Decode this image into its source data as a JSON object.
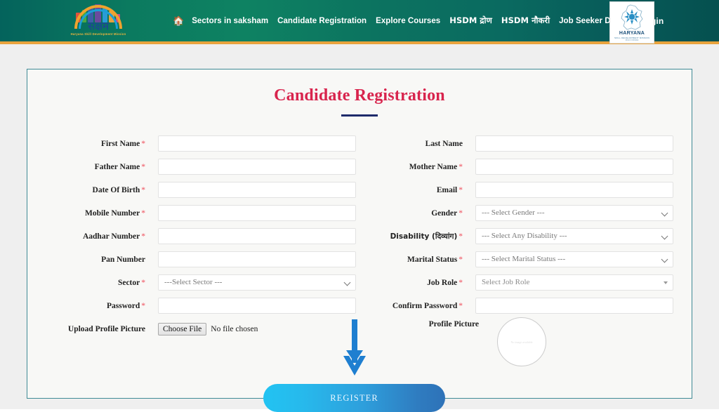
{
  "header": {
    "logo": {
      "name": "सक्षम",
      "subtitle": "Haryana Skill Development Mission"
    },
    "nav": {
      "home_icon": "home-icon",
      "items": [
        {
          "label": "Sectors in saksham",
          "script": "latin"
        },
        {
          "label": "Candidate Registration",
          "script": "latin"
        },
        {
          "label": "Explore Courses",
          "script": "latin"
        },
        {
          "label": "HSDM द्रोण",
          "script": "devanagari"
        },
        {
          "label": "HSDM नौकरी",
          "script": "devanagari"
        },
        {
          "label": "Job Seeker Details",
          "script": "latin"
        }
      ],
      "login_label": "Login"
    },
    "state_logo": {
      "name": "HARYANA",
      "tagline": "SKILL DEVELOPMENT MISSION",
      "subtagline": "कौशल से स्वावलंबन"
    }
  },
  "card": {
    "title": "Candidate Registration",
    "left_fields": [
      {
        "label": "First Name",
        "required": true,
        "type": "text",
        "value": ""
      },
      {
        "label": "Father Name",
        "required": true,
        "type": "text",
        "value": ""
      },
      {
        "label": "Date Of Birth",
        "required": true,
        "type": "text",
        "value": ""
      },
      {
        "label": "Mobile Number",
        "required": true,
        "type": "text",
        "value": ""
      },
      {
        "label": "Aadhar Number",
        "required": true,
        "type": "text",
        "value": ""
      },
      {
        "label": "Pan Number",
        "required": false,
        "type": "text",
        "value": ""
      },
      {
        "label": "Sector",
        "required": true,
        "type": "select",
        "value": "---Select Sector ---"
      },
      {
        "label": "Password",
        "required": true,
        "type": "text",
        "value": ""
      }
    ],
    "right_fields": [
      {
        "label": "Last Name",
        "required": false,
        "type": "text",
        "value": ""
      },
      {
        "label": "Mother Name",
        "required": true,
        "type": "text",
        "value": ""
      },
      {
        "label": "Email",
        "required": true,
        "type": "text",
        "value": ""
      },
      {
        "label": "Gender",
        "required": true,
        "type": "select",
        "value": "--- Select Gender ---"
      },
      {
        "label": "Disability (दिव्यांग)",
        "required": true,
        "type": "select",
        "value": "--- Select Any Disability ---"
      },
      {
        "label": "Marital Status",
        "required": true,
        "type": "select",
        "value": "--- Select Marital Status ---"
      },
      {
        "label": "Job Role",
        "required": true,
        "type": "select2",
        "value": "Select Job Role"
      },
      {
        "label": "Confirm Password",
        "required": true,
        "type": "text",
        "value": ""
      }
    ],
    "upload": {
      "label": "Upload Profile Picture",
      "button_label": "Choose File",
      "file_status": "No file chosen"
    },
    "profile_picture": {
      "label": "Profile Picture",
      "placeholder_text": "No image available"
    },
    "submit_label": "REGISTER"
  },
  "colors": {
    "header_gradient_start": "#04635c",
    "header_gradient_mid": "#0e8262",
    "header_border": "#e8a33d",
    "title_red": "#d8244d",
    "title_rule_navy": "#1e2a6b",
    "card_border_teal": "#3f8a96",
    "required_asterisk": "#ef4c5a",
    "button_gradient_start": "#22c3f2",
    "button_gradient_end": "#2e72b8",
    "arrow_blue": "#1f7fd0"
  }
}
